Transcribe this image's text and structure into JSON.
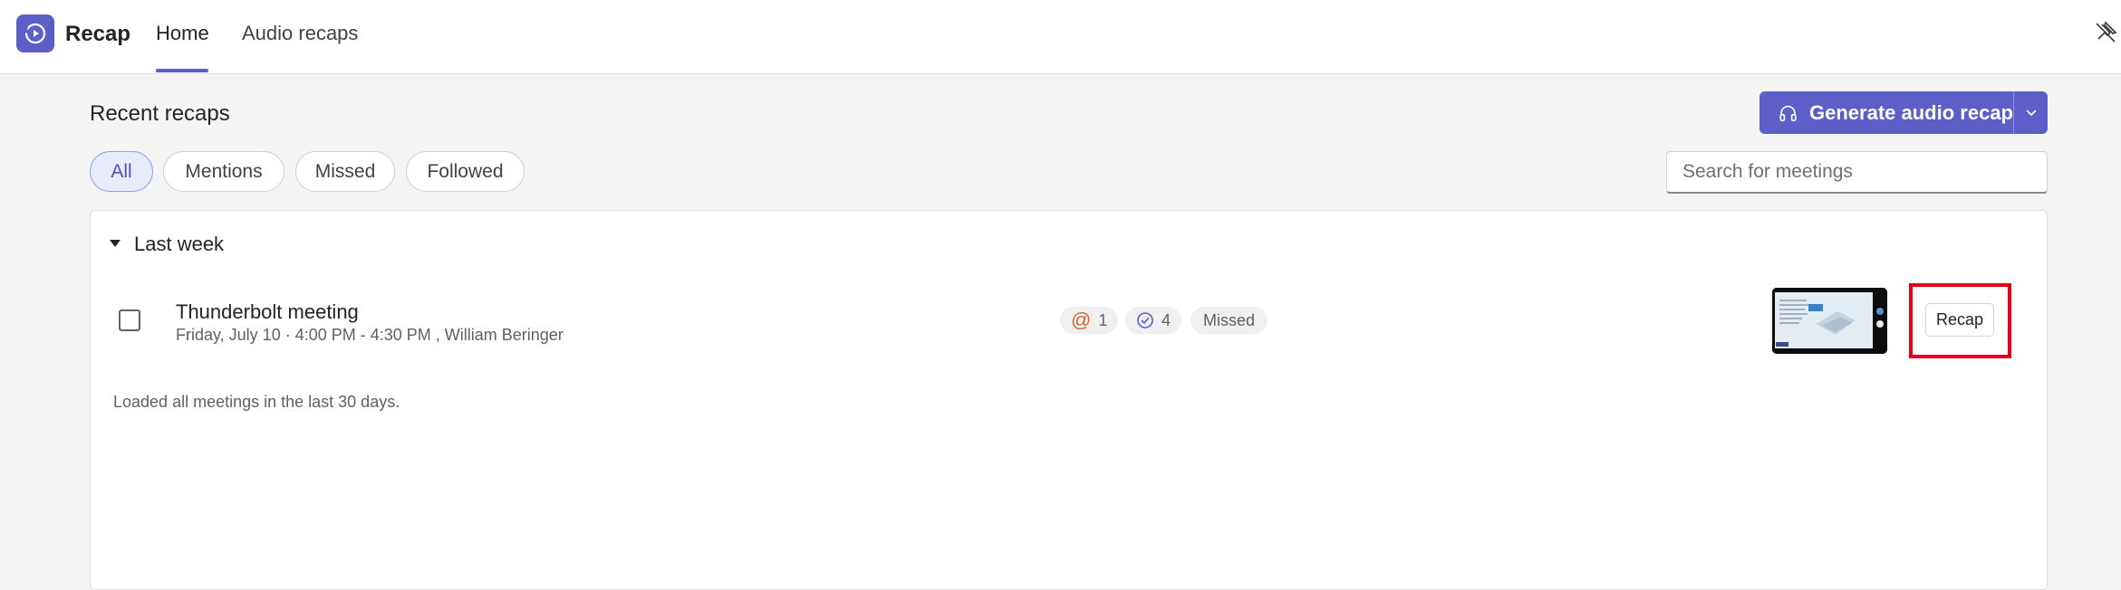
{
  "app": {
    "name": "Recap",
    "logo_color": "#5b5fc7"
  },
  "nav": {
    "tabs": [
      {
        "label": "Home",
        "active": true
      },
      {
        "label": "Audio recaps",
        "active": false
      }
    ]
  },
  "header": {
    "title": "Recent recaps",
    "generate_button": {
      "label": "Generate audio recap",
      "icon": "headphones-icon",
      "color": "#5b5fc7"
    }
  },
  "filters": {
    "chips": [
      {
        "label": "All",
        "active": true
      },
      {
        "label": "Mentions",
        "active": false
      },
      {
        "label": "Missed",
        "active": false
      },
      {
        "label": "Followed",
        "active": false
      }
    ]
  },
  "search": {
    "placeholder": "Search for meetings",
    "value": ""
  },
  "groups": [
    {
      "label": "Last week",
      "expanded": true,
      "meetings": [
        {
          "title": "Thunderbolt meeting",
          "subtitle": "Friday, July 10 · 4:00 PM - 4:30 PM , William Beringer",
          "mentions_count": "1",
          "tasks_count": "4",
          "status": "Missed",
          "action_label": "Recap",
          "highlight_color": "#e3001b"
        }
      ]
    }
  ],
  "footer_note": "Loaded all meetings in the last 30 days."
}
